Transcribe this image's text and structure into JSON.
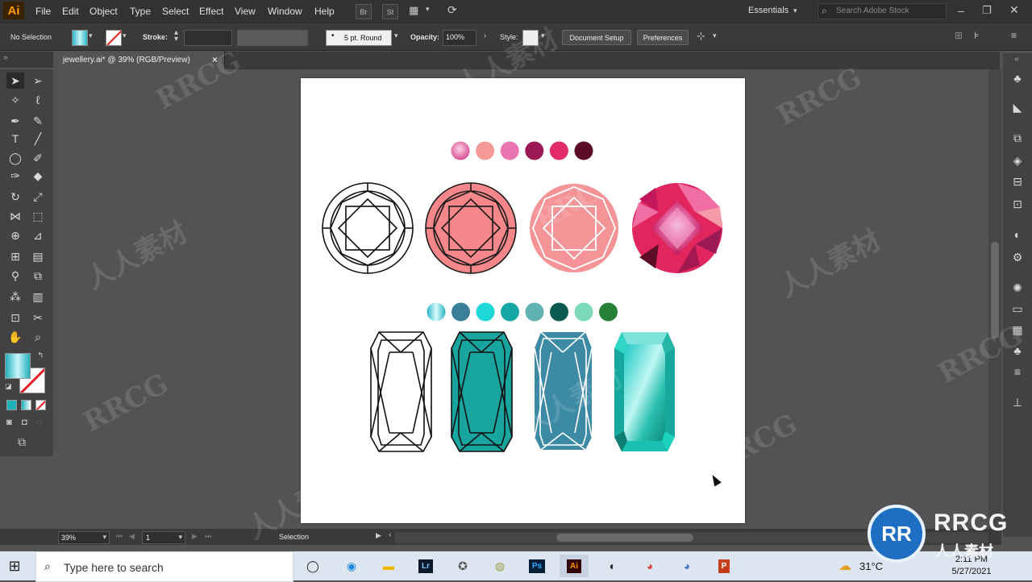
{
  "app": {
    "logo": "Ai"
  },
  "menu": [
    "File",
    "Edit",
    "Object",
    "Type",
    "Select",
    "Effect",
    "View",
    "Window",
    "Help"
  ],
  "menubar_icons": [
    "Br",
    "St"
  ],
  "workspace": "Essentials",
  "stock_search_placeholder": "Search Adobe Stock",
  "control": {
    "selection": "No Selection",
    "stroke_label": "Stroke:",
    "brush": "5 pt. Round",
    "opacity_label": "Opacity:",
    "opacity_value": "100%",
    "style_label": "Style:",
    "document_setup": "Document Setup",
    "preferences": "Preferences"
  },
  "document_tab": {
    "title": "jewellery.ai* @ 39% (RGB/Preview)",
    "close": "×"
  },
  "status": {
    "zoom": "39%",
    "artboard": "1",
    "tool": "Selection"
  },
  "swatches_pink": [
    "#e97fb0",
    "#f59898",
    "#ea76b1",
    "#9b1a55",
    "#e22b6a",
    "#5c0d25"
  ],
  "swatches_teal": [
    "#6fd3d6",
    "#3c7f99",
    "#1ed7d9",
    "#14a7a4",
    "#5fb1b2",
    "#0c5b50",
    "#7bd8b8",
    "#268035"
  ],
  "gem_colors": {
    "salmon": "#f5868a",
    "pink_light": "#f59497",
    "ruby": "#e0255f",
    "teal": "#18a49f",
    "steel": "#3d8aa5"
  },
  "taskbar": {
    "search_placeholder": "Type here to search",
    "apps": [
      "Task View",
      "Edge",
      "File Explorer",
      "Lightroom",
      "Gimp",
      "Photo",
      "Photoshop",
      "Illustrator",
      "OBS",
      "Chrome",
      "Chrome",
      "PowerPoint"
    ],
    "temperature": "31°C",
    "time": "2:11 PM",
    "date": "5/27/2021"
  },
  "watermark": {
    "text": "RRCG",
    "cn": "人人素材",
    "brand_cn": "人人素材",
    "brand_en": "RRCG"
  }
}
